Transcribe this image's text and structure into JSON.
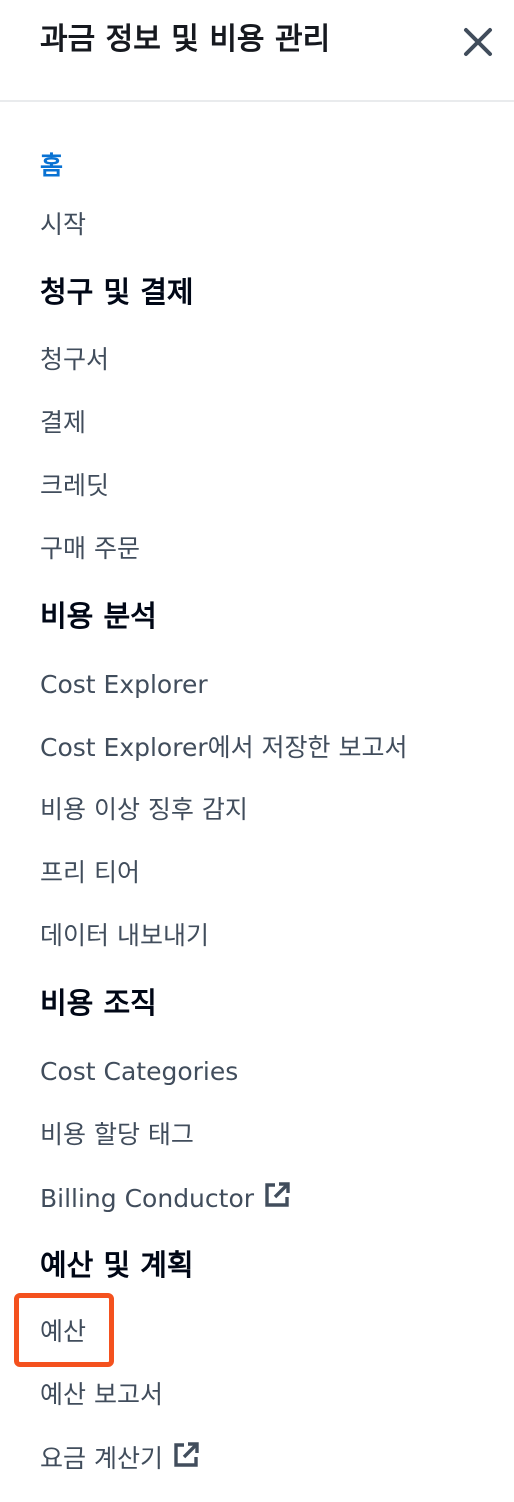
{
  "panel": {
    "title": "과금 정보 및 비용 관리",
    "close_icon": "close-icon"
  },
  "nav": {
    "home": "홈",
    "getting_started": "시작",
    "billing_section": {
      "title": "청구 및 결제",
      "items": [
        "청구서",
        "결제",
        "크레딧",
        "구매 주문"
      ]
    },
    "cost_analysis_section": {
      "title": "비용 분석",
      "items": [
        "Cost Explorer",
        "Cost Explorer에서 저장한 보고서",
        "비용 이상 징후 감지",
        "프리 티어",
        "데이터 내보내기"
      ]
    },
    "cost_org_section": {
      "title": "비용 조직",
      "items": [
        "Cost Categories",
        "비용 할당 태그",
        "Billing Conductor"
      ]
    },
    "budget_section": {
      "title": "예산 및 계획",
      "items": [
        "예산",
        "예산 보고서",
        "요금 계산기"
      ]
    }
  },
  "colors": {
    "active_link": "#0972d3",
    "link": "#414d5c",
    "section_heading": "#000716",
    "highlight_box": "#f4511e"
  }
}
